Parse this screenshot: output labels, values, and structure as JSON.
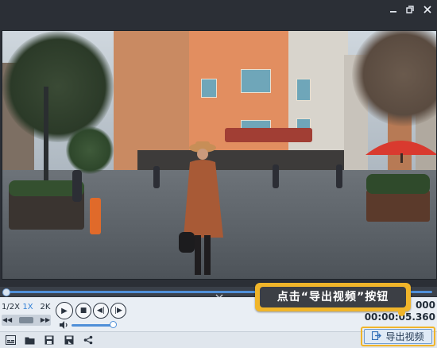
{
  "window": {
    "minimize_icon": "minimize-icon",
    "maximize_icon": "restore-icon",
    "close_icon": "close-icon"
  },
  "player": {
    "speeds": [
      "1/2X",
      "1X",
      "2K"
    ],
    "active_speed": "1X",
    "total_time": "000",
    "current_time": "00:00:05.360"
  },
  "callout": {
    "text": "点击“导出视频”按钮"
  },
  "toolbar": {
    "export_label": "导出视频"
  },
  "colors": {
    "accent": "#4f8fd8",
    "callout": "#f0b52a",
    "window_bg": "#2b2f36"
  }
}
